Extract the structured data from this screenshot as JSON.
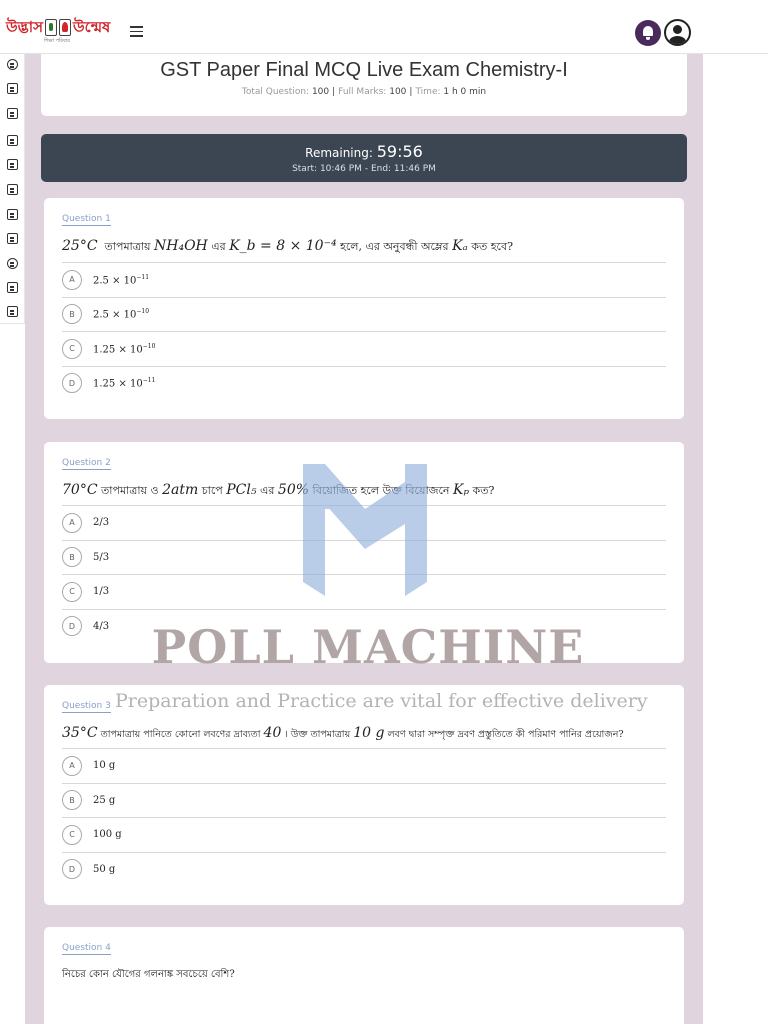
{
  "header": {
    "logo_text_left": "উদ্ভাস",
    "logo_text_right": "উন্মেষ",
    "logo_subtitle": "শিক্ষা পরিবার",
    "icons": {
      "menu": "hamburger-icon",
      "notifications": "bell-icon",
      "profile": "user-icon"
    }
  },
  "sidebar": {
    "items": [
      {
        "icon": "dashboard-icon"
      },
      {
        "icon": "inbox-icon"
      },
      {
        "icon": "list-icon"
      },
      {
        "icon": "table-icon"
      },
      {
        "icon": "monitor-icon"
      },
      {
        "icon": "book-icon"
      },
      {
        "icon": "archive-icon"
      },
      {
        "icon": "chart-icon"
      },
      {
        "icon": "question-icon"
      },
      {
        "icon": "card-icon"
      },
      {
        "icon": "image-icon"
      }
    ]
  },
  "exam": {
    "title": "GST Paper Final MCQ Live Exam Chemistry-I",
    "total_question_label": "Total Question:",
    "total_question_value": "100",
    "full_marks_label": "Full Marks:",
    "full_marks_value": "100",
    "time_label": "Time:",
    "time_value": "1 h 0 min"
  },
  "timer": {
    "remaining_label": "Remaining:",
    "remaining_value": "59:56",
    "start_label": "Start: 10:46 PM",
    "separator": "-",
    "end_label": "End: 11:46 PM"
  },
  "questions": [
    {
      "label": "Question 1",
      "text_parts": [
        "25°C",
        "তাপমাত্রায়",
        "NH₄OH",
        "এর",
        "K_b = 8 × 10⁻⁴",
        "হলে, এর অনুবন্ধী অম্লের",
        "Kₐ",
        "কত হবে?"
      ],
      "options": [
        {
          "letter": "A",
          "text": "2.5 × 10",
          "exp": "−11"
        },
        {
          "letter": "B",
          "text": "2.5 × 10",
          "exp": "−10"
        },
        {
          "letter": "C",
          "text": "1.25 × 10",
          "exp": "−10"
        },
        {
          "letter": "D",
          "text": "1.25 × 10",
          "exp": "−11"
        }
      ]
    },
    {
      "label": "Question 2",
      "text_parts": [
        "70°C",
        "তাপমাত্রায় ও",
        "2atm",
        "চাপে",
        "PCl₅",
        "এর",
        "50%",
        "বিয়োজিত হলে উক্ত বিয়োজনে",
        "Kₚ",
        "কত?"
      ],
      "options": [
        {
          "letter": "A",
          "text": "2/3"
        },
        {
          "letter": "B",
          "text": "5/3"
        },
        {
          "letter": "C",
          "text": "1/3"
        },
        {
          "letter": "D",
          "text": "4/3"
        }
      ]
    },
    {
      "label": "Question 3",
      "text_parts": [
        "35°C",
        "তাপমাত্রায় পানিতে কোনো লবণের দ্রাব্যতা",
        "40",
        "। উক্ত তাপমাত্রায়",
        "10 g",
        "লবণ দ্বারা সম্পৃক্ত দ্রবণ প্রস্তুতিতে কী পরিমাণ পানির প্রয়োজন?"
      ],
      "options": [
        {
          "letter": "A",
          "text": "10 g"
        },
        {
          "letter": "B",
          "text": "25 g"
        },
        {
          "letter": "C",
          "text": "100 g"
        },
        {
          "letter": "D",
          "text": "50 g"
        }
      ]
    },
    {
      "label": "Question 4",
      "text_parts": [
        "নিচের কোন যৌগের গলনাঙ্ক সবচেয়ে বেশি?"
      ],
      "options": []
    }
  ],
  "watermark": {
    "brand": "POLL MACHINE",
    "overlay_text": "Preparation and Practice are vital for effective delivery",
    "logo_icon": "poll-machine-logo-icon",
    "logo_color": "#9fb9dd"
  },
  "colors": {
    "background": "#e0d5de",
    "timer_bg": "#3b4652",
    "question_label": "#8aa0c8",
    "brand_red": "#d1262b",
    "notification_bg": "#4a2a5c"
  }
}
